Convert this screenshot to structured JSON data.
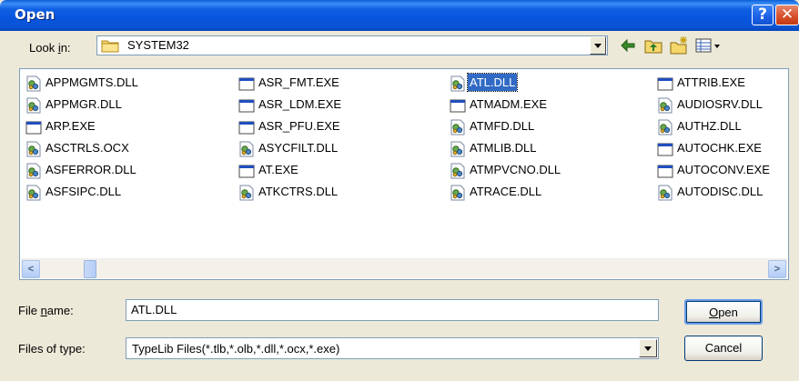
{
  "window": {
    "title": "Open",
    "help_glyph": "?",
    "close_glyph": "✕"
  },
  "lookin": {
    "label_pre": "Look ",
    "label_ul": "i",
    "label_post": "n:",
    "value": "SYSTEM32",
    "icon": "folder-icon"
  },
  "toolbar": {
    "icons": [
      "back-arrow-icon",
      "up-folder-icon",
      "new-folder-icon",
      "view-menu-icon"
    ]
  },
  "files": {
    "columns": [
      [
        {
          "name": "APPMGMTS.DLL",
          "type": "dll"
        },
        {
          "name": "APPMGR.DLL",
          "type": "dll"
        },
        {
          "name": "ARP.EXE",
          "type": "exe"
        },
        {
          "name": "ASCTRLS.OCX",
          "type": "dll"
        },
        {
          "name": "ASFERROR.DLL",
          "type": "dll"
        },
        {
          "name": "ASFSIPC.DLL",
          "type": "dll"
        }
      ],
      [
        {
          "name": "ASR_FMT.EXE",
          "type": "exe"
        },
        {
          "name": "ASR_LDM.EXE",
          "type": "exe"
        },
        {
          "name": "ASR_PFU.EXE",
          "type": "exe"
        },
        {
          "name": "ASYCFILT.DLL",
          "type": "dll"
        },
        {
          "name": "AT.EXE",
          "type": "exe"
        },
        {
          "name": "ATKCTRS.DLL",
          "type": "dll"
        }
      ],
      [
        {
          "name": "ATL.DLL",
          "type": "dll",
          "selected": true
        },
        {
          "name": "ATMADM.EXE",
          "type": "exe"
        },
        {
          "name": "ATMFD.DLL",
          "type": "dll"
        },
        {
          "name": "ATMLIB.DLL",
          "type": "dll"
        },
        {
          "name": "ATMPVCNO.DLL",
          "type": "dll"
        },
        {
          "name": "ATRACE.DLL",
          "type": "dll"
        }
      ],
      [
        {
          "name": "ATTRIB.EXE",
          "type": "exe"
        },
        {
          "name": "AUDIOSRV.DLL",
          "type": "dll"
        },
        {
          "name": "AUTHZ.DLL",
          "type": "dll"
        },
        {
          "name": "AUTOCHK.EXE",
          "type": "exe"
        },
        {
          "name": "AUTOCONV.EXE",
          "type": "exe"
        },
        {
          "name": "AUTODISC.DLL",
          "type": "dll"
        }
      ]
    ]
  },
  "scroll": {
    "left_glyph": "<",
    "right_glyph": ">"
  },
  "filename": {
    "label_pre": "File ",
    "label_ul": "n",
    "label_post": "ame:",
    "value": "ATL.DLL"
  },
  "filetype": {
    "label": "Files of type:",
    "value": "TypeLib Files(*.tlb,*.olb,*.dll,*.ocx,*.exe)"
  },
  "buttons": {
    "open_ul": "O",
    "open_post": "pen",
    "cancel": "Cancel"
  },
  "colors": {
    "titlebar": "#0855dd",
    "selection": "#316ac5",
    "window_bg": "#ece9d8"
  }
}
